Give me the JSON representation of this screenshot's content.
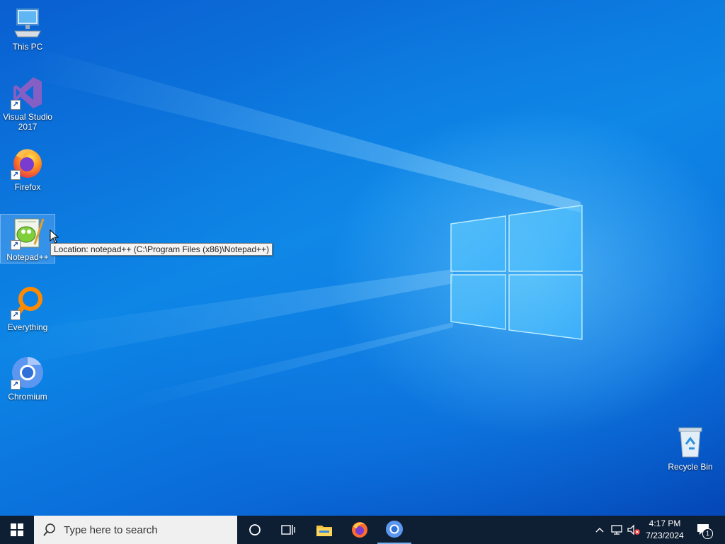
{
  "desktop": {
    "icons": [
      {
        "label": "This PC",
        "icon": "computer-icon"
      },
      {
        "label": "Visual Studio 2017",
        "icon": "visual-studio-icon"
      },
      {
        "label": "Firefox",
        "icon": "firefox-icon"
      },
      {
        "label": "Notepad++",
        "icon": "notepad-plus-plus-icon"
      },
      {
        "label": "Everything",
        "icon": "everything-search-icon"
      },
      {
        "label": "Chromium",
        "icon": "chromium-icon"
      },
      {
        "label": "Recycle Bin",
        "icon": "recycle-bin-icon"
      }
    ],
    "tooltip": "Location: notepad++ (C:\\Program Files (x86)\\Notepad++)"
  },
  "taskbar": {
    "search_placeholder": "Type here to search",
    "apps": [
      "cortana-icon",
      "task-view-icon",
      "file-explorer-icon",
      "firefox-icon",
      "chromium-icon"
    ],
    "tray": {
      "time": "4:17 PM",
      "date": "7/23/2024",
      "notification_count": "1"
    }
  },
  "colors": {
    "taskbar": "#0f1f33",
    "desktop_blue": "#0d86e6"
  }
}
